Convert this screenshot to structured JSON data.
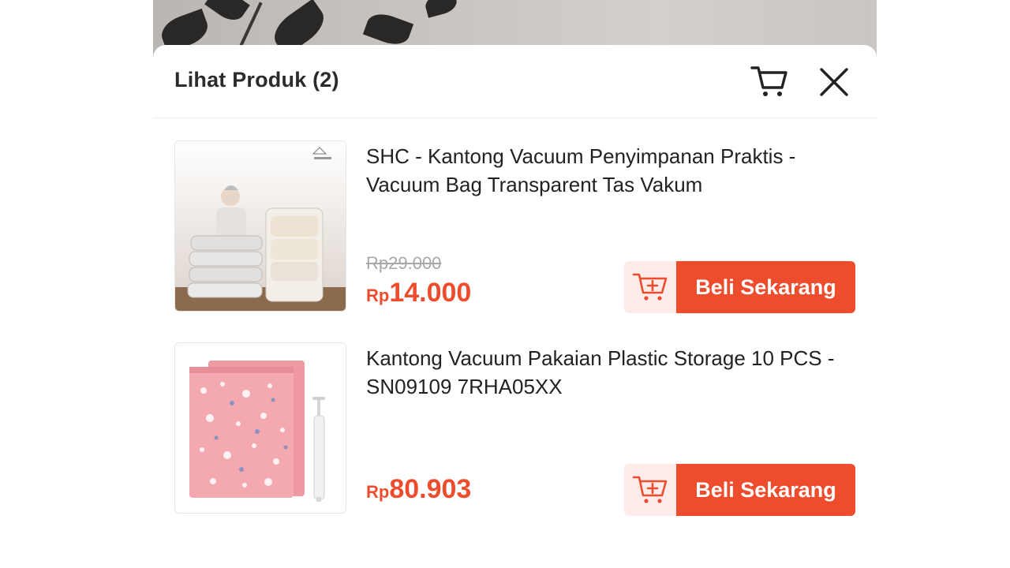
{
  "header": {
    "title": "Lihat Produk (2)",
    "cart_icon": "cart-icon",
    "close_icon": "close-icon"
  },
  "products": [
    {
      "name": "SHC - Kantong Vacuum Penyimpanan Praktis - Vacuum Bag Transparent Tas Vakum",
      "original_price": "Rp29.000",
      "currency": "Rp",
      "price": "14.000",
      "buy_label": "Beli Sekarang",
      "add_to_cart_icon": "add-to-cart-icon"
    },
    {
      "name": "Kantong Vacuum Pakaian Plastic Storage 10 PCS - SN09109 7RHA05XX",
      "currency": "Rp",
      "price": "80.903",
      "buy_label": "Beli Sekarang",
      "add_to_cart_icon": "add-to-cart-icon"
    }
  ],
  "colors": {
    "accent": "#ee4d2d",
    "accent_light": "#fdecea",
    "text": "#222222",
    "muted": "#a8a8a8"
  }
}
